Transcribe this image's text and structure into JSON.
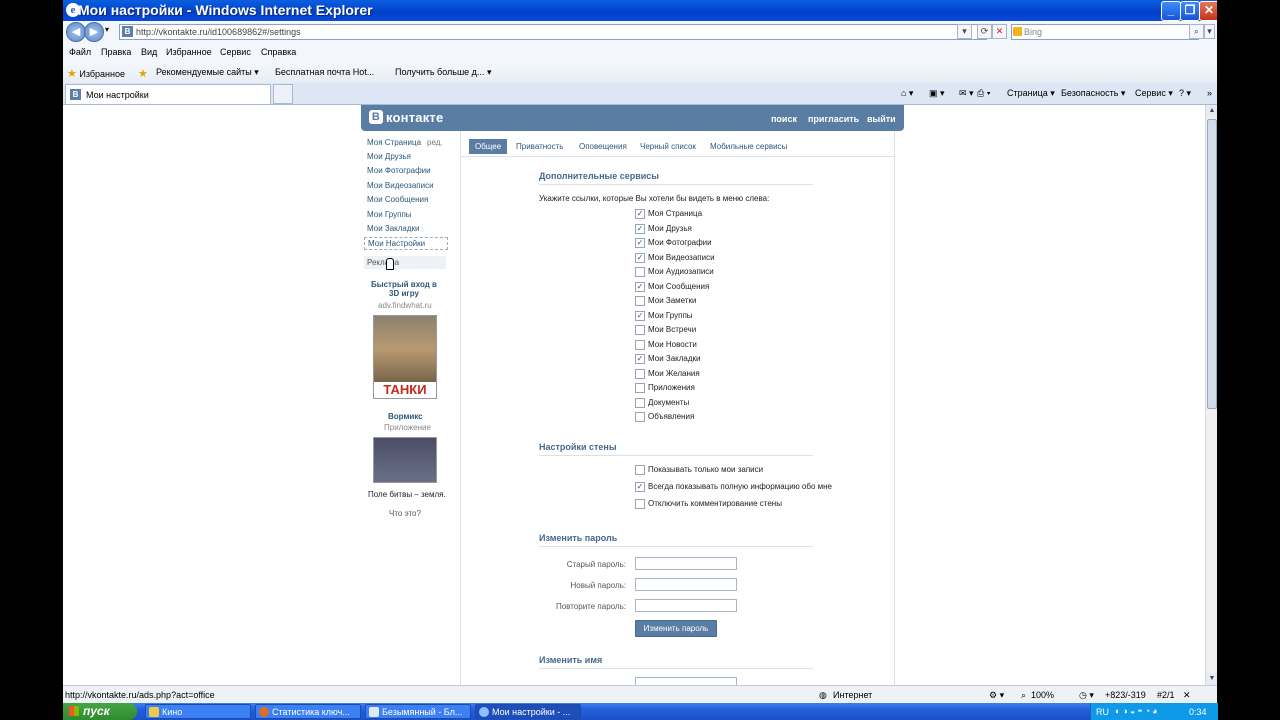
{
  "window": {
    "title": "Мои настройки - Windows Internet Explorer",
    "address": "http://vkontakte.ru/id100689862#/settings",
    "search_placeholder": "Bing"
  },
  "menu": [
    "Файл",
    "Правка",
    "Вид",
    "Избранное",
    "Сервис",
    "Справка"
  ],
  "favorites": {
    "favorites_label": "Избранное",
    "items": [
      "Рекомендуемые сайты ▾",
      "Бесплатная почта Hot...",
      "Получить больше д... ▾"
    ]
  },
  "tab": {
    "label": "Мои настройки"
  },
  "commandbar": [
    "Страница ▾",
    "Безопасность ▾",
    "Сервис ▾"
  ],
  "vk": {
    "logo": "контакте",
    "header_links": [
      "поиск",
      "пригласить",
      "выйти"
    ],
    "left_menu": [
      "Моя Страница",
      "Мои Друзья",
      "Мои Фотографии",
      "Мои Видеозаписи",
      "Мои Сообщения",
      "Мои Группы",
      "Мои Закладки",
      "Мои Настройки"
    ],
    "edit_link": "ред.",
    "ads_label": "Реклама",
    "ad1_title": "Быстрый вход в 3D игру",
    "ad1_domain": "adv.findwhat.ru",
    "ad1_image_text": "ТАНКИ",
    "ad2_title": "Вормикс",
    "ad2_sub": "Приложение",
    "ad2_caption": "Поле битвы – земля.",
    "what_is": "Что это?",
    "tabs": [
      "Общее",
      "Приватность",
      "Оповещения",
      "Черный список",
      "Мобильные сервисы"
    ],
    "services_title": "Дополнительные сервисы",
    "services_hint": "Укажите ссылки, которые Вы хотели бы видеть в меню слева:",
    "services": [
      {
        "label": "Моя Страница",
        "checked": true
      },
      {
        "label": "Мои Друзья",
        "checked": true
      },
      {
        "label": "Мои Фотографии",
        "checked": true
      },
      {
        "label": "Мои Видеозаписи",
        "checked": true
      },
      {
        "label": "Мои Аудиозаписи",
        "checked": false
      },
      {
        "label": "Мои Сообщения",
        "checked": true
      },
      {
        "label": "Мои Заметки",
        "checked": false
      },
      {
        "label": "Мои Группы",
        "checked": true
      },
      {
        "label": "Мои Встречи",
        "checked": false
      },
      {
        "label": "Мои Новости",
        "checked": false
      },
      {
        "label": "Мои Закладки",
        "checked": true
      },
      {
        "label": "Мои Желания",
        "checked": false
      },
      {
        "label": "Приложения",
        "checked": false
      },
      {
        "label": "Документы",
        "checked": false
      },
      {
        "label": "Объявления",
        "checked": false
      }
    ],
    "wall_title": "Настройки стены",
    "wall": [
      {
        "label": "Показывать только мои записи",
        "checked": false
      },
      {
        "label": "Всегда показывать полную информацию обо мне",
        "checked": true
      },
      {
        "label": "Отключить комментирование стены",
        "checked": false
      }
    ],
    "password_title": "Изменить пароль",
    "old_password": "Старый пароль:",
    "new_password": "Новый пароль:",
    "repeat_password": "Повторите пароль:",
    "change_password_btn": "Изменить пароль",
    "name_title": "Изменить имя"
  },
  "status": {
    "url": "http://vkontakte.ru/ads.php?act=office",
    "zone": "Интернет",
    "zoom": "100%",
    "extra": "+823/-319",
    "page": "#2/1"
  },
  "taskbar": {
    "start": "пуск",
    "tasks": [
      "Кино",
      "Статистика ключ...",
      "Безымянный - Бл...",
      "Мои настройки - ..."
    ],
    "lang": "RU",
    "clock": "0:34"
  }
}
